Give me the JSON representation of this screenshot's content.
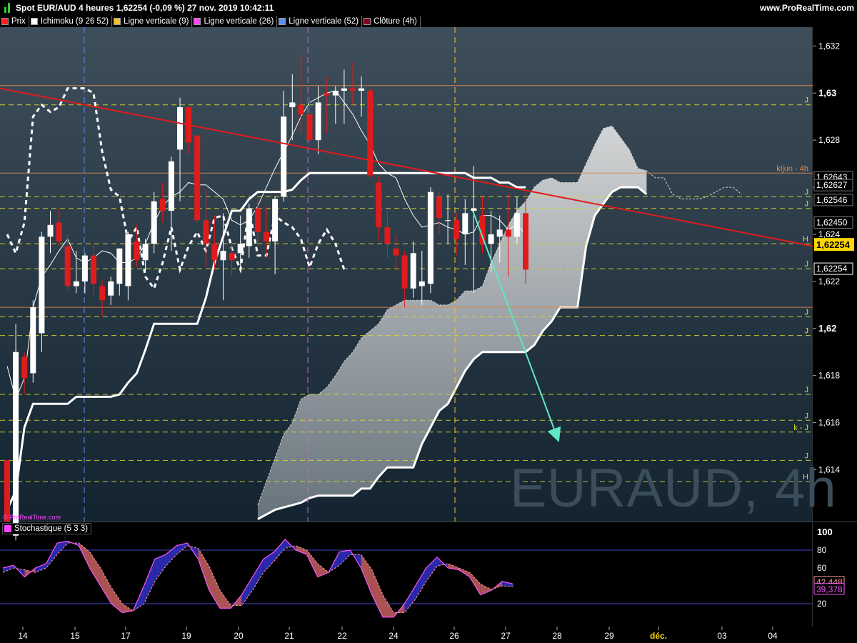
{
  "header": {
    "title": "Spot EUR/AUD 4 heures 1,62254 (-0,09 %) 27 nov. 2019 10:42:11",
    "site": "www.ProRealTime.com",
    "small_watermark": "© ProRealTime.com",
    "watermark": "EURAUD, 4h"
  },
  "legend": [
    {
      "label": "Prix",
      "color": "#ff2020"
    },
    {
      "label": "Ichimoku (9 26 52)",
      "color": "#ffffff"
    },
    {
      "label": "Ligne verticale (9)",
      "color": "#f2c12e"
    },
    {
      "label": "Ligne verticale (26)",
      "color": "#ff44ff"
    },
    {
      "label": "Ligne verticale (52)",
      "color": "#5b8ff9"
    },
    {
      "label": "Clôture (4h)",
      "color": "#8b0020"
    }
  ],
  "colors": {
    "up_candle": "#ffffff",
    "down_candle": "#e11b1b",
    "trendline": "#e11b1b",
    "arrow": "#5ee8c5",
    "kumo": "#c8c8c8",
    "level_yellow": "#d8d82a",
    "level_orange": "#e08a4a",
    "stoch_k_over": "#3030c8",
    "stoch_k_under": "#c86060"
  },
  "chart_data": [
    {
      "type": "candlestick",
      "title": "Spot EUR/AUD 4 heures",
      "x_ticks": [
        "14",
        "15",
        "17",
        "19",
        "20",
        "21",
        "22",
        "24",
        "26",
        "27",
        "28",
        "29",
        "déc.",
        "03",
        "04"
      ],
      "y_ticks": [
        "1,614",
        "1,616",
        "1,618",
        "1,62",
        "1,622",
        "1,624",
        "1,626",
        "1,628",
        "1,63",
        "1,632"
      ],
      "ylim": [
        1.6118,
        1.6328
      ],
      "price_labels": [
        "1,62643",
        "1,62627",
        "1,62546",
        "1,62450",
        "1,62254"
      ],
      "current_price": "1,62254",
      "level_lines": [
        {
          "value": 1.63032,
          "color": "orange",
          "label": ""
        },
        {
          "value": 1.6295,
          "color": "yellow",
          "label": "J"
        },
        {
          "value": 1.6266,
          "color": "orange",
          "label": "kijun  - 4h"
        },
        {
          "value": 1.6256,
          "color": "yellow",
          "label": "J"
        },
        {
          "value": 1.6251,
          "color": "yellow",
          "label": "J"
        },
        {
          "value": 1.6236,
          "color": "yellow",
          "label": "H"
        },
        {
          "value": 1.62254,
          "color": "yellow",
          "label": "J"
        },
        {
          "value": 1.6209,
          "color": "orange",
          "label": ""
        },
        {
          "value": 1.6205,
          "color": "yellow",
          "label": "J"
        },
        {
          "value": 1.6197,
          "color": "yellow",
          "label": "J"
        },
        {
          "value": 1.6172,
          "color": "yellow",
          "label": "J"
        },
        {
          "value": 1.6161,
          "color": "yellow",
          "label": "J"
        },
        {
          "value": 1.6156,
          "color": "yellow",
          "label": "k - J"
        },
        {
          "value": 1.6144,
          "color": "yellow",
          "label": "J"
        },
        {
          "value": 1.6135,
          "color": "yellow",
          "label": "H"
        }
      ],
      "candles": [
        {
          "o": 1.6144,
          "h": 1.6136,
          "l": 1.6118,
          "c": 1.6118
        },
        {
          "o": 1.6112,
          "h": 1.6202,
          "l": 1.611,
          "c": 1.619
        },
        {
          "o": 1.6188,
          "h": 1.619,
          "l": 1.6172,
          "c": 1.6179
        },
        {
          "o": 1.6181,
          "h": 1.6212,
          "l": 1.6177,
          "c": 1.6209
        },
        {
          "o": 1.6198,
          "h": 1.6241,
          "l": 1.619,
          "c": 1.6239
        },
        {
          "o": 1.6239,
          "h": 1.625,
          "l": 1.6232,
          "c": 1.6244
        },
        {
          "o": 1.6245,
          "h": 1.6251,
          "l": 1.6235,
          "c": 1.6237
        },
        {
          "o": 1.6235,
          "h": 1.624,
          "l": 1.6216,
          "c": 1.6218
        },
        {
          "o": 1.6218,
          "h": 1.6233,
          "l": 1.6215,
          "c": 1.622
        },
        {
          "o": 1.622,
          "h": 1.6232,
          "l": 1.6215,
          "c": 1.6231
        },
        {
          "o": 1.6231,
          "h": 1.6236,
          "l": 1.6214,
          "c": 1.6219
        },
        {
          "o": 1.6218,
          "h": 1.6221,
          "l": 1.6205,
          "c": 1.6212
        },
        {
          "o": 1.6214,
          "h": 1.6222,
          "l": 1.621,
          "c": 1.622
        },
        {
          "o": 1.6219,
          "h": 1.6231,
          "l": 1.6214,
          "c": 1.6234
        },
        {
          "o": 1.6218,
          "h": 1.6241,
          "l": 1.6212,
          "c": 1.624
        },
        {
          "o": 1.6237,
          "h": 1.6244,
          "l": 1.6226,
          "c": 1.6229
        },
        {
          "o": 1.6229,
          "h": 1.6238,
          "l": 1.6224,
          "c": 1.6236
        },
        {
          "o": 1.6236,
          "h": 1.6258,
          "l": 1.6232,
          "c": 1.6254
        },
        {
          "o": 1.6255,
          "h": 1.6262,
          "l": 1.6245,
          "c": 1.625
        },
        {
          "o": 1.625,
          "h": 1.6273,
          "l": 1.6233,
          "c": 1.6271
        },
        {
          "o": 1.6276,
          "h": 1.6298,
          "l": 1.6254,
          "c": 1.6294
        },
        {
          "o": 1.6294,
          "h": 1.629,
          "l": 1.6274,
          "c": 1.6279
        },
        {
          "o": 1.6282,
          "h": 1.627,
          "l": 1.6245,
          "c": 1.6246
        },
        {
          "o": 1.6246,
          "h": 1.6259,
          "l": 1.6226,
          "c": 1.6236
        },
        {
          "o": 1.6236,
          "h": 1.6248,
          "l": 1.6225,
          "c": 1.6229
        },
        {
          "o": 1.6229,
          "h": 1.6249,
          "l": 1.6212,
          "c": 1.6233
        },
        {
          "o": 1.6232,
          "h": 1.6238,
          "l": 1.6222,
          "c": 1.6229
        },
        {
          "o": 1.6232,
          "h": 1.6248,
          "l": 1.6226,
          "c": 1.6236
        },
        {
          "o": 1.6235,
          "h": 1.6253,
          "l": 1.623,
          "c": 1.6251
        },
        {
          "o": 1.6251,
          "h": 1.6256,
          "l": 1.6236,
          "c": 1.6241
        },
        {
          "o": 1.6241,
          "h": 1.6252,
          "l": 1.623,
          "c": 1.6237
        },
        {
          "o": 1.6237,
          "h": 1.6256,
          "l": 1.6223,
          "c": 1.6255
        },
        {
          "o": 1.6256,
          "h": 1.6301,
          "l": 1.6254,
          "c": 1.629
        },
        {
          "o": 1.6294,
          "h": 1.6308,
          "l": 1.628,
          "c": 1.6296
        },
        {
          "o": 1.6295,
          "h": 1.6316,
          "l": 1.6283,
          "c": 1.6291
        },
        {
          "o": 1.6291,
          "h": 1.6299,
          "l": 1.6279,
          "c": 1.628
        },
        {
          "o": 1.628,
          "h": 1.6303,
          "l": 1.6274,
          "c": 1.6296
        },
        {
          "o": 1.63,
          "h": 1.6307,
          "l": 1.6283,
          "c": 1.6299
        },
        {
          "o": 1.6299,
          "h": 1.6303,
          "l": 1.6287,
          "c": 1.6301
        },
        {
          "o": 1.6301,
          "h": 1.631,
          "l": 1.6287,
          "c": 1.6302
        },
        {
          "o": 1.6302,
          "h": 1.6313,
          "l": 1.6295,
          "c": 1.6301
        },
        {
          "o": 1.6301,
          "h": 1.6307,
          "l": 1.629,
          "c": 1.6302
        },
        {
          "o": 1.6301,
          "h": 1.6302,
          "l": 1.6264,
          "c": 1.6265
        },
        {
          "o": 1.6262,
          "h": 1.6265,
          "l": 1.6237,
          "c": 1.6243
        },
        {
          "o": 1.6243,
          "h": 1.625,
          "l": 1.623,
          "c": 1.6236
        },
        {
          "o": 1.6234,
          "h": 1.624,
          "l": 1.6225,
          "c": 1.6231
        },
        {
          "o": 1.6231,
          "h": 1.6233,
          "l": 1.6209,
          "c": 1.6217
        },
        {
          "o": 1.6217,
          "h": 1.6237,
          "l": 1.6213,
          "c": 1.6232
        },
        {
          "o": 1.6218,
          "h": 1.6233,
          "l": 1.621,
          "c": 1.622
        },
        {
          "o": 1.6219,
          "h": 1.626,
          "l": 1.6215,
          "c": 1.6258
        },
        {
          "o": 1.6256,
          "h": 1.6258,
          "l": 1.624,
          "c": 1.6247
        },
        {
          "o": 1.6246,
          "h": 1.6257,
          "l": 1.6236,
          "c": 1.6246
        },
        {
          "o": 1.6246,
          "h": 1.6249,
          "l": 1.6231,
          "c": 1.6238
        },
        {
          "o": 1.624,
          "h": 1.6255,
          "l": 1.6227,
          "c": 1.6249
        },
        {
          "o": 1.625,
          "h": 1.6269,
          "l": 1.6215,
          "c": 1.6251
        },
        {
          "o": 1.6248,
          "h": 1.6256,
          "l": 1.6232,
          "c": 1.6236
        },
        {
          "o": 1.6236,
          "h": 1.625,
          "l": 1.6224,
          "c": 1.624
        },
        {
          "o": 1.6239,
          "h": 1.6248,
          "l": 1.6228,
          "c": 1.6242
        },
        {
          "o": 1.6242,
          "h": 1.6257,
          "l": 1.6222,
          "c": 1.6239
        },
        {
          "o": 1.6239,
          "h": 1.6256,
          "l": 1.6236,
          "c": 1.6249
        },
        {
          "o": 1.6249,
          "h": 1.6258,
          "l": 1.6219,
          "c": 1.6225
        }
      ],
      "tenkan": [
        1.6184,
        1.617,
        1.6179,
        1.6209,
        1.6222,
        1.6227,
        1.6233,
        1.6238,
        1.623,
        1.6228,
        1.623,
        1.6233,
        1.6232,
        1.6228,
        1.6228,
        1.623,
        1.6236,
        1.6245,
        1.6252,
        1.6256,
        1.6258,
        1.6262,
        1.6261,
        1.6261,
        1.6258,
        1.6255,
        1.6246,
        1.6244,
        1.6246,
        1.6252,
        1.626,
        1.6268,
        1.6275,
        1.6282,
        1.629,
        1.6296,
        1.6298,
        1.63,
        1.6301,
        1.6296,
        1.6291,
        1.6284,
        1.6278,
        1.627,
        1.6266,
        1.6264,
        1.6255,
        1.6248,
        1.6243,
        1.6244,
        1.6245,
        1.6243,
        1.6242,
        1.624,
        1.6241,
        1.6248,
        1.6248,
        1.6246,
        1.6242,
        1.6244,
        1.624
      ],
      "kijun": [
        1.6123,
        1.6131,
        1.6158,
        1.6168,
        1.6168,
        1.6168,
        1.6168,
        1.6168,
        1.6171,
        1.6171,
        1.6171,
        1.6171,
        1.6171,
        1.6172,
        1.6177,
        1.6181,
        1.6191,
        1.6202,
        1.6202,
        1.6202,
        1.6202,
        1.6202,
        1.6202,
        1.6213,
        1.6228,
        1.6239,
        1.625,
        1.625,
        1.6255,
        1.6258,
        1.6258,
        1.6258,
        1.6258,
        1.6259,
        1.6263,
        1.6266,
        1.6266,
        1.6266,
        1.6266,
        1.6266,
        1.6266,
        1.6266,
        1.6266,
        1.6266,
        1.6266,
        1.6266,
        1.6266,
        1.6266,
        1.6266,
        1.6266,
        1.6266,
        1.6266,
        1.6266,
        1.6266,
        1.6264,
        1.6264,
        1.6264,
        1.6262,
        1.6262,
        1.626,
        1.626
      ],
      "chikou": [
        1.624,
        1.6232,
        1.6245,
        1.629,
        1.6295,
        1.6292,
        1.6294,
        1.6302,
        1.6302,
        1.6302,
        1.63,
        1.6275,
        1.6259,
        1.6256,
        1.6237,
        1.6243,
        1.6222,
        1.6217,
        1.6228,
        1.6243,
        1.6225,
        1.6235,
        1.6241,
        1.6233,
        1.6247,
        1.6248,
        1.6234,
        1.6225,
        1.6251,
        1.6231,
        1.6231,
        1.6248,
        1.6245,
        1.6243,
        1.6238,
        1.6226,
        1.6236,
        1.6242,
        1.6236,
        1.6225
      ],
      "senkou_a": [
        1.6125,
        1.6135,
        1.6145,
        1.6155,
        1.616,
        1.617,
        1.6172,
        1.6172,
        1.6175,
        1.618,
        1.6186,
        1.619,
        1.6196,
        1.6199,
        1.6202,
        1.6208,
        1.621,
        1.6212,
        1.6212,
        1.6212,
        1.6212,
        1.621,
        1.621,
        1.6212,
        1.6216,
        1.6216,
        1.6218,
        1.6228,
        1.6236,
        1.6244,
        1.625,
        1.6254,
        1.626,
        1.6263,
        1.6264,
        1.6262,
        1.6262,
        1.6262,
        1.627,
        1.6278,
        1.6285,
        1.6286,
        1.6281,
        1.6276,
        1.6268,
        1.6267,
        1.6264,
        1.6264,
        1.6257,
        1.6255,
        1.6255,
        1.6255,
        1.6256,
        1.6258,
        1.626,
        1.626,
        1.6257
      ],
      "senkou_b": [
        1.6119,
        1.6121,
        1.6123,
        1.6124,
        1.6125,
        1.6126,
        1.6128,
        1.6129,
        1.6129,
        1.6129,
        1.6129,
        1.6129,
        1.6132,
        1.6132,
        1.6137,
        1.6141,
        1.6141,
        1.6141,
        1.6141,
        1.6151,
        1.6158,
        1.6165,
        1.6168,
        1.6175,
        1.6182,
        1.6187,
        1.619,
        1.619,
        1.619,
        1.619,
        1.619,
        1.619,
        1.6193,
        1.6199,
        1.6203,
        1.6209,
        1.6209,
        1.6209,
        1.6235,
        1.6248,
        1.6253,
        1.6258,
        1.626,
        1.626,
        1.626,
        1.6257
      ],
      "trendline": {
        "from": 1.6302,
        "to": 1.6235
      },
      "arrow": {
        "from": 1.625,
        "to": 1.6154
      }
    },
    {
      "type": "line",
      "title": "Stochastique (5 3 3)",
      "y_ticks": [
        "100",
        "80",
        "60",
        "20"
      ],
      "ylim": [
        0,
        100
      ],
      "levels": [
        80,
        20
      ],
      "value_labels": [
        "42,448",
        "39,378"
      ],
      "k": [
        60,
        63,
        50,
        60,
        65,
        88,
        90,
        85,
        60,
        40,
        20,
        10,
        12,
        40,
        70,
        75,
        85,
        88,
        70,
        35,
        15,
        15,
        30,
        50,
        70,
        78,
        92,
        80,
        75,
        50,
        55,
        78,
        80,
        60,
        30,
        5,
        5,
        20,
        40,
        60,
        72,
        60,
        58,
        50,
        30,
        35,
        45,
        42
      ],
      "d": [
        55,
        60,
        58,
        55,
        60,
        75,
        88,
        88,
        78,
        60,
        38,
        20,
        12,
        20,
        45,
        62,
        75,
        85,
        82,
        62,
        35,
        18,
        18,
        35,
        55,
        68,
        82,
        85,
        80,
        65,
        55,
        63,
        75,
        75,
        58,
        30,
        10,
        10,
        25,
        45,
        62,
        65,
        60,
        55,
        42,
        36,
        40,
        39
      ]
    }
  ]
}
